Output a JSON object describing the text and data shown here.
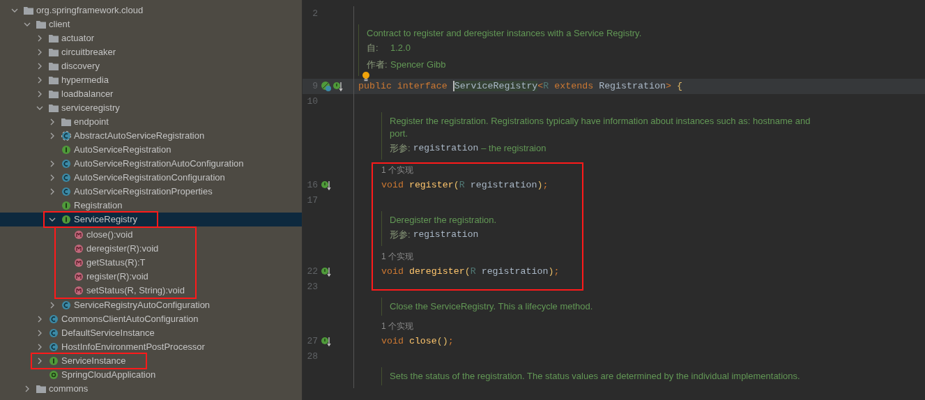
{
  "project_tree": {
    "items": [
      {
        "label": "org.springframework.cloud",
        "kind": "folder",
        "expanded": true,
        "selected": false,
        "highlighted": false,
        "children": [
          {
            "label": "client",
            "kind": "folder",
            "expanded": true,
            "selected": false,
            "highlighted": false,
            "children": [
              {
                "label": "actuator",
                "kind": "folder",
                "expanded": false,
                "selected": false,
                "highlighted": false
              },
              {
                "label": "circuitbreaker",
                "kind": "folder",
                "expanded": false,
                "selected": false,
                "highlighted": false
              },
              {
                "label": "discovery",
                "kind": "folder",
                "expanded": false,
                "selected": false,
                "highlighted": false
              },
              {
                "label": "hypermedia",
                "kind": "folder",
                "expanded": false,
                "selected": false,
                "highlighted": false
              },
              {
                "label": "loadbalancer",
                "kind": "folder",
                "expanded": false,
                "selected": false,
                "highlighted": false
              },
              {
                "label": "serviceregistry",
                "kind": "folder",
                "expanded": true,
                "selected": false,
                "highlighted": false,
                "children": [
                  {
                    "label": "endpoint",
                    "kind": "folder",
                    "expanded": false,
                    "selected": false,
                    "highlighted": false
                  },
                  {
                    "label": "AbstractAutoServiceRegistration",
                    "kind": "abstract_class",
                    "expanded": false,
                    "selected": false,
                    "highlighted": false
                  },
                  {
                    "label": "AutoServiceRegistration",
                    "kind": "interface",
                    "selected": false,
                    "highlighted": false
                  },
                  {
                    "label": "AutoServiceRegistrationAutoConfiguration",
                    "kind": "class",
                    "expanded": false,
                    "selected": false,
                    "highlighted": false
                  },
                  {
                    "label": "AutoServiceRegistrationConfiguration",
                    "kind": "class",
                    "expanded": false,
                    "selected": false,
                    "highlighted": false
                  },
                  {
                    "label": "AutoServiceRegistrationProperties",
                    "kind": "class",
                    "expanded": false,
                    "selected": false,
                    "highlighted": false
                  },
                  {
                    "label": "Registration",
                    "kind": "interface",
                    "selected": false,
                    "highlighted": false
                  },
                  {
                    "label": "ServiceRegistry",
                    "kind": "interface",
                    "expanded": true,
                    "selected": true,
                    "highlighted": true,
                    "children_highlighted": true,
                    "children": [
                      {
                        "label": "close():void",
                        "kind": "method",
                        "selected": false,
                        "highlighted": false
                      },
                      {
                        "label": "deregister(R):void",
                        "kind": "method",
                        "selected": false,
                        "highlighted": false
                      },
                      {
                        "label": "getStatus(R):T",
                        "kind": "method",
                        "selected": false,
                        "highlighted": false
                      },
                      {
                        "label": "register(R):void",
                        "kind": "method",
                        "selected": false,
                        "highlighted": false
                      },
                      {
                        "label": "setStatus(R, String):void",
                        "kind": "method",
                        "selected": false,
                        "highlighted": false
                      }
                    ]
                  },
                  {
                    "label": "ServiceRegistryAutoConfiguration",
                    "kind": "class",
                    "expanded": false,
                    "selected": false,
                    "highlighted": false
                  }
                ]
              },
              {
                "label": "CommonsClientAutoConfiguration",
                "kind": "class",
                "expanded": false,
                "selected": false,
                "highlighted": false
              },
              {
                "label": "DefaultServiceInstance",
                "kind": "class",
                "expanded": false,
                "selected": false,
                "highlighted": false
              },
              {
                "label": "HostInfoEnvironmentPostProcessor",
                "kind": "class",
                "expanded": false,
                "selected": false,
                "highlighted": false
              },
              {
                "label": "ServiceInstance",
                "kind": "interface",
                "expanded": false,
                "selected": false,
                "highlighted": true
              },
              {
                "label": "SpringCloudApplication",
                "kind": "annotation",
                "selected": false,
                "highlighted": false
              }
            ]
          },
          {
            "label": "commons",
            "kind": "folder",
            "expanded": false,
            "selected": false,
            "highlighted": false
          }
        ]
      }
    ]
  },
  "editor": {
    "blocks": [
      {
        "kind": "code",
        "number": "2"
      },
      {
        "kind": "doc",
        "bulb": true,
        "paragraphs": [
          {
            "kind": "text",
            "text": "Contract to register and deregister instances with a Service Registry."
          },
          {
            "kind": "tag",
            "label": "自:",
            "text": "1.2.0"
          },
          {
            "kind": "tag",
            "label": "作者:",
            "text": "Spencer Gibb"
          }
        ]
      },
      {
        "kind": "code",
        "number": "9",
        "current": true,
        "implemented": true,
        "has_implementations": true,
        "tokens": [
          {
            "text": "public ",
            "kind": "keyword"
          },
          {
            "text": "interface ",
            "kind": "keyword"
          },
          {
            "text": "ServiceRegistry",
            "kind": "class_decl"
          },
          {
            "text": "<",
            "kind": "punct"
          },
          {
            "text": "R ",
            "kind": "typeparam"
          },
          {
            "text": "extends ",
            "kind": "keyword"
          },
          {
            "text": "Registration",
            "kind": "ident"
          },
          {
            "text": "> ",
            "kind": "punct"
          },
          {
            "text": "{",
            "kind": "brace"
          }
        ],
        "body": [
          {
            "kind": "code",
            "number": "10"
          },
          {
            "kind": "doc",
            "paragraphs": [
              {
                "kind": "text",
                "text": "Register the registration. Registrations typically have information about instances such as: hostname and port."
              },
              {
                "kind": "tag",
                "label": "形参:",
                "code": "registration",
                "text": "– the registraion"
              }
            ]
          },
          {
            "kind": "group",
            "highlighted": true,
            "blocks": [
              {
                "kind": "hint",
                "text": "1 个实现"
              },
              {
                "kind": "code",
                "number": "16",
                "has_implementations": true,
                "tokens": [
                  {
                    "text": "void ",
                    "kind": "keyword"
                  },
                  {
                    "text": "register",
                    "kind": "method"
                  },
                  {
                    "text": "(",
                    "kind": "brace"
                  },
                  {
                    "text": "R ",
                    "kind": "typeparam"
                  },
                  {
                    "text": "registration",
                    "kind": "ident"
                  },
                  {
                    "text": ")",
                    "kind": "brace"
                  },
                  {
                    "text": ";",
                    "kind": "punct"
                  }
                ]
              },
              {
                "kind": "code",
                "number": "17"
              },
              {
                "kind": "doc",
                "paragraphs": [
                  {
                    "kind": "text",
                    "text": "Deregister the registration."
                  },
                  {
                    "kind": "tag",
                    "label": "形参:",
                    "code": "registration"
                  }
                ]
              },
              {
                "kind": "hint",
                "text": "1 个实现"
              },
              {
                "kind": "code",
                "number": "22",
                "has_implementations": true,
                "tokens": [
                  {
                    "text": "void ",
                    "kind": "keyword"
                  },
                  {
                    "text": "deregister",
                    "kind": "method"
                  },
                  {
                    "text": "(",
                    "kind": "brace"
                  },
                  {
                    "text": "R ",
                    "kind": "typeparam"
                  },
                  {
                    "text": "registration",
                    "kind": "ident"
                  },
                  {
                    "text": ")",
                    "kind": "brace"
                  },
                  {
                    "text": ";",
                    "kind": "punct"
                  }
                ]
              }
            ]
          },
          {
            "kind": "code",
            "number": "23"
          },
          {
            "kind": "doc",
            "paragraphs": [
              {
                "kind": "text",
                "text": "Close the ServiceRegistry. This a lifecycle method."
              }
            ]
          },
          {
            "kind": "hint",
            "text": "1 个实现"
          },
          {
            "kind": "code",
            "number": "27",
            "has_implementations": true,
            "tokens": [
              {
                "text": "void ",
                "kind": "keyword"
              },
              {
                "text": "close",
                "kind": "method"
              },
              {
                "text": "()",
                "kind": "brace"
              },
              {
                "text": ";",
                "kind": "punct"
              }
            ]
          },
          {
            "kind": "code",
            "number": "28"
          },
          {
            "kind": "doc",
            "paragraphs": [
              {
                "kind": "text",
                "text": "Sets the status of the registration. The status values are determined by the individual implementations."
              }
            ]
          }
        ]
      }
    ]
  }
}
